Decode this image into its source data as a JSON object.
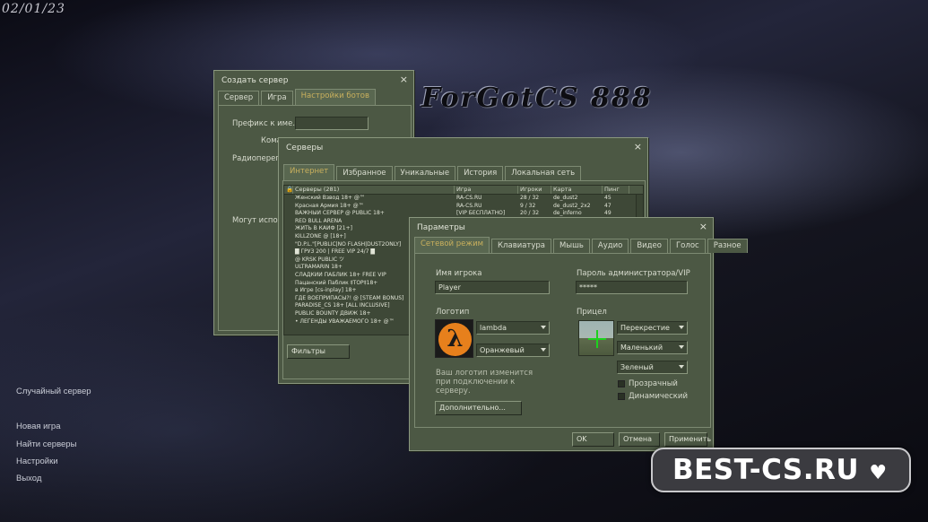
{
  "date": "02/01/23",
  "logo_text": "ForGotCS 888",
  "watermark": {
    "text": "BEST-CS.RU",
    "heart": "♥"
  },
  "main_menu": {
    "random_server": "Случайный сервер",
    "new_game": "Новая игра",
    "find_servers": "Найти серверы",
    "settings": "Настройки",
    "exit": "Выход"
  },
  "create_server": {
    "title": "Создать сервер",
    "close": "×",
    "tabs": [
      "Сервер",
      "Игра",
      "Настройки ботов"
    ],
    "fields": [
      "Префикс к име...",
      "Кома",
      "Радиоперегов",
      "Могут исполь"
    ]
  },
  "servers": {
    "title": "Серверы",
    "close": "×",
    "tabs": [
      "Интернет",
      "Избранное",
      "Уникальные",
      "История",
      "Локальная сеть"
    ],
    "headers": {
      "lock": "🔒",
      "name": "Серверы (281)",
      "game": "Игра",
      "players": "Игроки",
      "map": "Карта",
      "ping": "Пинг"
    },
    "rows": [
      {
        "name": "Женский Взвод 18+ @™",
        "game": "RA-CS.RU",
        "players": "28 / 32",
        "map": "de_dust2",
        "ping": "45"
      },
      {
        "name": "Красная Армия 18+ @™",
        "game": "RA-CS.RU",
        "players": "9 / 32",
        "map": "de_dust2_2x2",
        "ping": "47"
      },
      {
        "name": "ВАЖНЫЙ СЕРВЕР @ PUBLIC 18+",
        "game": "[VIP БЕСПЛАТНО]",
        "players": "20 / 32",
        "map": "de_inferno",
        "ping": "49"
      },
      {
        "name": "RED BULL ARENA",
        "game": "",
        "players": "",
        "map": "",
        "ping": ""
      },
      {
        "name": "ЖИТЬ В КАЙФ [21+]",
        "game": "",
        "players": "",
        "map": "",
        "ping": ""
      },
      {
        "name": "KILLZONE @ [18+]",
        "game": "",
        "players": "",
        "map": "",
        "ping": ""
      },
      {
        "name": "\"D.P.L.\"[PUBLIC|NO FLASH|DUST2ONLY]",
        "game": "",
        "players": "",
        "map": "",
        "ping": ""
      },
      {
        "name": "█ ГРУЗ 200 | FREE VIP 24/7 █",
        "game": "",
        "players": "",
        "map": "",
        "ping": ""
      },
      {
        "name": "@ KRSK PUBLIC ツ",
        "game": "",
        "players": "",
        "map": "",
        "ping": ""
      },
      {
        "name": "ULTRAMARIN 18+",
        "game": "",
        "players": "",
        "map": "",
        "ping": ""
      },
      {
        "name": "СЛАДКИЙ ПАБЛИК 18+ FREE VIP",
        "game": "",
        "players": "",
        "map": "",
        "ping": ""
      },
      {
        "name": "Пацанский Паблик ‡TOP‡18+",
        "game": "",
        "players": "",
        "map": "",
        "ping": ""
      },
      {
        "name": "в Игре [cs-inplay] 18+",
        "game": "",
        "players": "",
        "map": "",
        "ping": ""
      },
      {
        "name": "ГДЕ ВОЕПРИПАСЫ?! @ [STEAM BONUS]",
        "game": "",
        "players": "",
        "map": "",
        "ping": ""
      },
      {
        "name": "PARADISE_CS 18+ [ALL INCLUSIVE]",
        "game": "",
        "players": "",
        "map": "",
        "ping": ""
      },
      {
        "name": "PUBLIC BOUNTY ДВИЖ 18+",
        "game": "",
        "players": "",
        "map": "",
        "ping": ""
      },
      {
        "name": "• ЛЕГЕНДЫ УВАЖАЕМОГО 18+ @™",
        "game": "",
        "players": "",
        "map": "",
        "ping": ""
      }
    ],
    "filters_button": "Фильтры"
  },
  "params": {
    "title": "Параметры",
    "close": "×",
    "tabs": [
      "Сетевой режим",
      "Клавиатура",
      "Мышь",
      "Аудио",
      "Видео",
      "Голос",
      "Разное"
    ],
    "player_name_label": "Имя игрока",
    "player_name_value": "Player",
    "admin_password_label": "Пароль администратора/VIP",
    "admin_password_value": "*****",
    "logo_label": "Логотип",
    "logo_select": "lambda",
    "logo_color": "Оранжевый",
    "crosshair_label": "Прицел",
    "crosshair_type": "Перекрестие",
    "crosshair_size": "Маленький",
    "crosshair_color": "Зеленый",
    "transparent_label": "Прозрачный",
    "dynamic_label": "Динамический",
    "logo_note": "Ваш логотип изменится при подключении к серверу.",
    "advanced_button": "Дополнительно...",
    "ok_button": "OK",
    "cancel_button": "Отмена",
    "apply_button": "Применить",
    "lambda_glyph": "λ"
  }
}
